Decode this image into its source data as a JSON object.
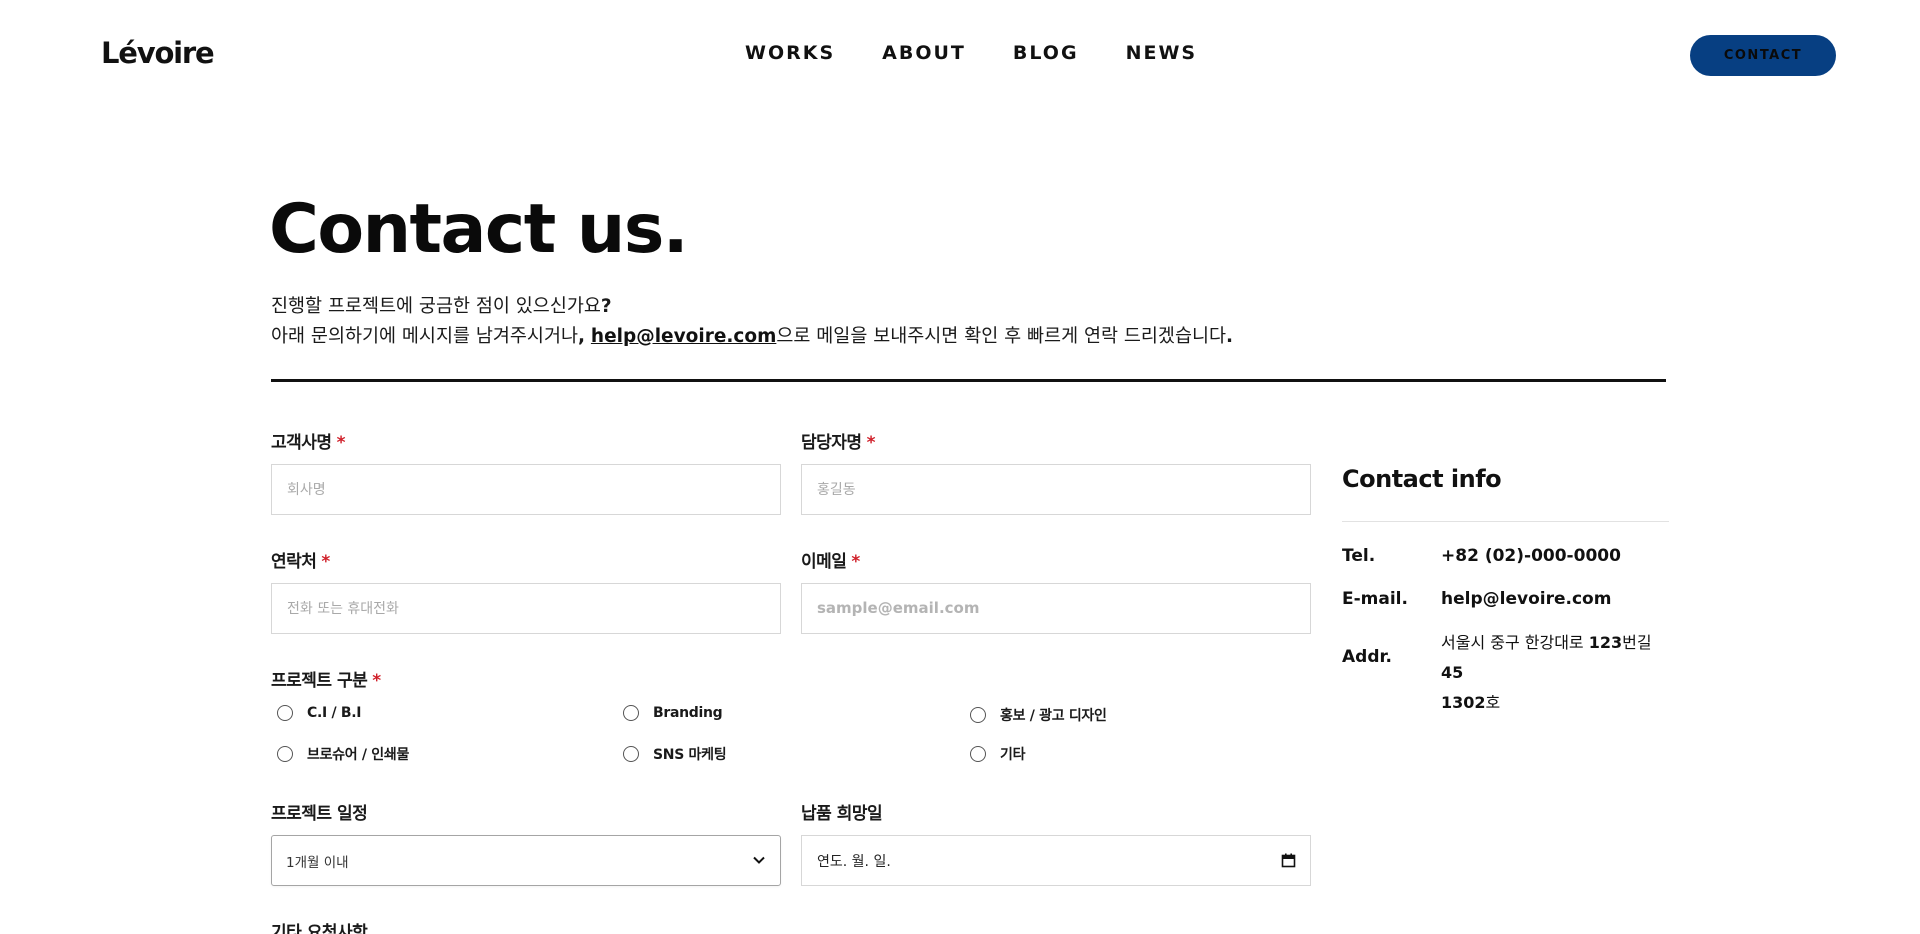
{
  "header": {
    "logo": "Lévoire",
    "nav": [
      "WORKS",
      "ABOUT",
      "BLOG",
      "NEWS"
    ],
    "contact_label": "CONTACT"
  },
  "hero": {
    "title": "Contact us.",
    "line1_text": "진행할 프로젝트에 궁금한 점이 있으신가요",
    "line1_mark": "?",
    "line2_before": "아래 문의하기에 메시지를 남겨주시거나",
    "line2_comma": ",",
    "email_link": "help@levoire.com",
    "line2_after": "으로 메일을 보내주시면 확인 후 빠르게 연락 드리겠습니다",
    "line2_end": "."
  },
  "form": {
    "required_mark": "*",
    "client_name": {
      "label": "고객사명",
      "placeholder": "회사명"
    },
    "manager_name": {
      "label": "담당자명",
      "placeholder": "홍길동"
    },
    "phone": {
      "label": "연락처",
      "placeholder": "전화 또는 휴대전화"
    },
    "email": {
      "label": "이메일",
      "placeholder": "sample@email.com"
    },
    "project_type": {
      "label": "프로젝트 구분",
      "options": [
        "C.I / B.I",
        "Branding",
        "홍보 / 광고 디자인",
        "브로슈어 / 인쇄물",
        "SNS 마케팅",
        "기타"
      ]
    },
    "schedule": {
      "label": "프로젝트 일정",
      "selected": "1개월 이내"
    },
    "due_date": {
      "label": "납품 희망일",
      "placeholder": "연도. 월. 일."
    },
    "other": {
      "label": "기타 요청사항"
    }
  },
  "contact_info": {
    "title": "Contact info",
    "tel_label": "Tel.",
    "tel_value": "+82 (02)-000-0000",
    "email_label": "E-mail.",
    "email_value": "help@levoire.com",
    "addr_label": "Addr.",
    "addr_part1": "서울시 중구 한강대로 ",
    "addr_num1": "123",
    "addr_part2": "번길 ",
    "addr_num2": "45",
    "addr_num3": "1302",
    "addr_part3": "호"
  },
  "colors": {
    "accent": "#073f82",
    "required": "#d0202a"
  }
}
